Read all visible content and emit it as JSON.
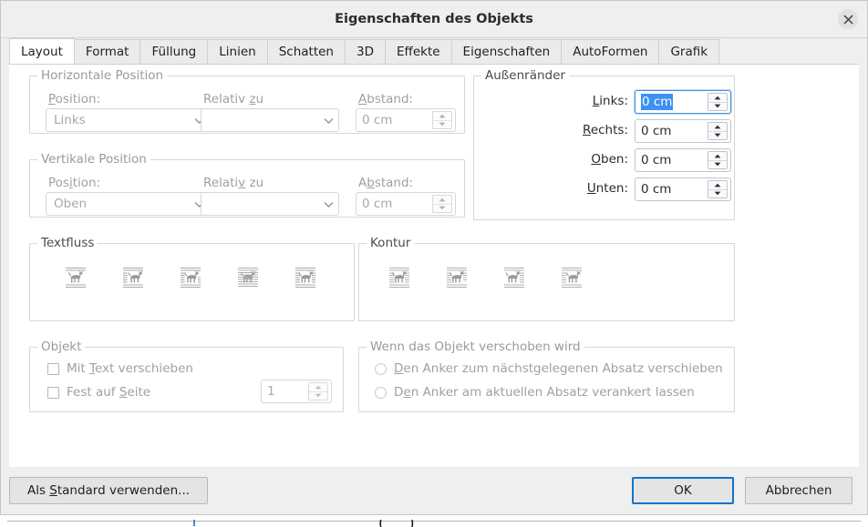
{
  "window": {
    "title": "Eigenschaften des Objekts",
    "close_icon": "close-icon"
  },
  "tabs": [
    {
      "label": "Layout",
      "active": true
    },
    {
      "label": "Format",
      "active": false
    },
    {
      "label": "Füllung",
      "active": false
    },
    {
      "label": "Linien",
      "active": false
    },
    {
      "label": "Schatten",
      "active": false
    },
    {
      "label": "3D",
      "active": false
    },
    {
      "label": "Effekte",
      "active": false
    },
    {
      "label": "Eigenschaften",
      "active": false
    },
    {
      "label": "AutoFormen",
      "active": false
    },
    {
      "label": "Grafik",
      "active": false
    }
  ],
  "horizontal_position": {
    "legend": "Horizontale Position",
    "position_label": "Position:",
    "position_value": "Links",
    "relative_label": "Relativ zu",
    "relative_value": "",
    "distance_label": "Abstand:",
    "distance_value": "0 cm",
    "enabled": false
  },
  "vertical_position": {
    "legend": "Vertikale Position",
    "position_label": "Position:",
    "position_value": "Oben",
    "relative_label": "Relativ zu",
    "relative_value": "",
    "distance_label": "Abstand:",
    "distance_value": "0 cm",
    "enabled": false
  },
  "margins": {
    "legend": "Außenränder",
    "left_label": "Links:",
    "left_value": "0 cm",
    "right_label": "Rechts:",
    "right_value": "0 cm",
    "top_label": "Oben:",
    "top_value": "0 cm",
    "bottom_label": "Unten:",
    "bottom_value": "0 cm",
    "focused_field": "left",
    "selection_highlight": "#3d91f0"
  },
  "text_flow": {
    "legend": "Textfluss",
    "options": [
      {
        "name": "wrap-none-icon",
        "title": "Kein Umlauf"
      },
      {
        "name": "wrap-before-icon",
        "title": "Vor"
      },
      {
        "name": "wrap-after-icon",
        "title": "Nach"
      },
      {
        "name": "wrap-through-icon",
        "title": "Durchlauf"
      },
      {
        "name": "wrap-parallel-icon",
        "title": "Parallel"
      }
    ]
  },
  "contour": {
    "legend": "Kontur",
    "options": [
      {
        "name": "contour-first-icon",
        "title": "Kontur"
      },
      {
        "name": "contour-second-icon",
        "title": "Nur außen"
      },
      {
        "name": "contour-third-icon",
        "title": "Links"
      },
      {
        "name": "contour-fourth-icon",
        "title": "Rechts"
      }
    ]
  },
  "object": {
    "legend": "Objekt",
    "move_with_text_label": "Mit Text verschieben",
    "move_with_text_checked": false,
    "fix_on_page_label": "Fest auf Seite",
    "fix_on_page_checked": false,
    "page_value": "1",
    "enabled": false
  },
  "when_moved": {
    "legend": "Wenn das Objekt verschoben wird",
    "options": [
      {
        "label": "Den Anker zum nächstgelegenen Absatz verschieben",
        "selected": false
      },
      {
        "label": "Den Anker am aktuellen Absatz verankert lassen",
        "selected": false
      }
    ],
    "enabled": false
  },
  "footer": {
    "default_button": "Als Standard verwenden...",
    "ok_button": "OK",
    "cancel_button": "Abbrechen",
    "focus_color": "#1473cc"
  }
}
